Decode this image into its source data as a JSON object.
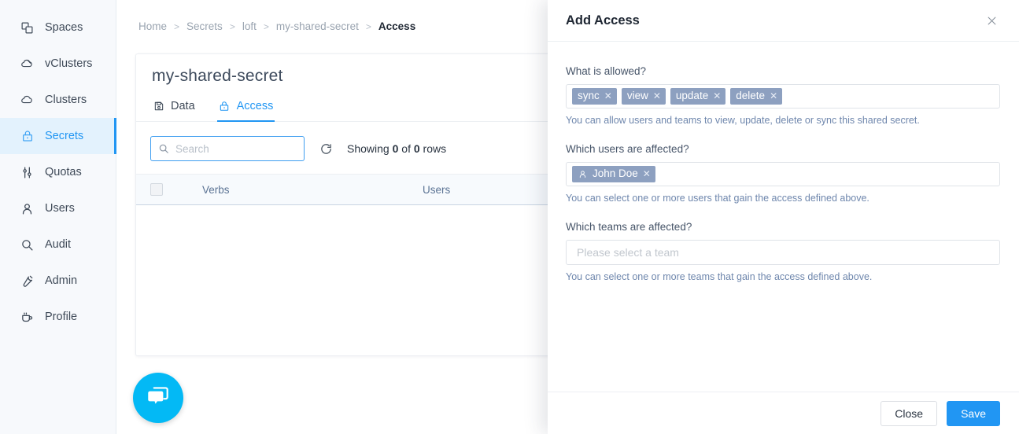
{
  "sidebar": {
    "items": [
      {
        "label": "Spaces",
        "icon": "spaces-icon",
        "active": false
      },
      {
        "label": "vClusters",
        "icon": "vclusters-icon",
        "active": false
      },
      {
        "label": "Clusters",
        "icon": "clusters-icon",
        "active": false
      },
      {
        "label": "Secrets",
        "icon": "lock-icon",
        "active": true
      },
      {
        "label": "Quotas",
        "icon": "sliders-icon",
        "active": false
      },
      {
        "label": "Users",
        "icon": "user-icon",
        "active": false
      },
      {
        "label": "Audit",
        "icon": "search-icon",
        "active": false
      },
      {
        "label": "Admin",
        "icon": "wrench-icon",
        "active": false
      },
      {
        "label": "Profile",
        "icon": "cup-icon",
        "active": false
      }
    ]
  },
  "breadcrumb": {
    "separator": ">",
    "items": [
      {
        "label": "Home",
        "current": false
      },
      {
        "label": "Secrets",
        "current": false
      },
      {
        "label": "loft",
        "current": false
      },
      {
        "label": "my-shared-secret",
        "current": false
      },
      {
        "label": "Access",
        "current": true
      }
    ]
  },
  "card": {
    "title": "my-shared-secret",
    "tabs": [
      {
        "label": "Data",
        "icon": "save-icon",
        "active": false
      },
      {
        "label": "Access",
        "icon": "lock-icon",
        "active": true
      }
    ],
    "toolbar": {
      "search_placeholder": "Search",
      "search_value": "",
      "refresh_icon": "refresh-icon",
      "rows_prefix": "Showing",
      "rows_shown": "0",
      "rows_middle": "of",
      "rows_total": "0",
      "rows_suffix": "rows"
    },
    "table": {
      "columns": [
        "Verbs",
        "Users"
      ],
      "rows": []
    }
  },
  "drawer": {
    "title": "Add Access",
    "close_icon": "close-icon",
    "fields": [
      {
        "label": "What is allowed?",
        "help": "You can allow users and teams to view, update, delete or sync this shared secret.",
        "chips": [
          {
            "text": "sync",
            "icon": null
          },
          {
            "text": "view",
            "icon": null
          },
          {
            "text": "update",
            "icon": null
          },
          {
            "text": "delete",
            "icon": null
          }
        ],
        "placeholder": ""
      },
      {
        "label": "Which users are affected?",
        "help": "You can select one or more users that gain the access defined above.",
        "chips": [
          {
            "text": "John Doe",
            "icon": "user-icon"
          }
        ],
        "placeholder": ""
      },
      {
        "label": "Which teams are affected?",
        "help": "You can select one or more teams that gain the access defined above.",
        "chips": [],
        "placeholder": "Please select a team"
      }
    ],
    "footer": {
      "close_label": "Close",
      "save_label": "Save"
    }
  },
  "chat_widget": {
    "icon": "chat-bubbles-icon"
  },
  "colors": {
    "accent": "#2196f3",
    "chip": "#8da0c0",
    "sidebar_bg": "#f7f9fc",
    "active_nav_bg": "#e3f2fd",
    "chat_fab": "#03b9f5",
    "help_text": "#6f87ad"
  }
}
